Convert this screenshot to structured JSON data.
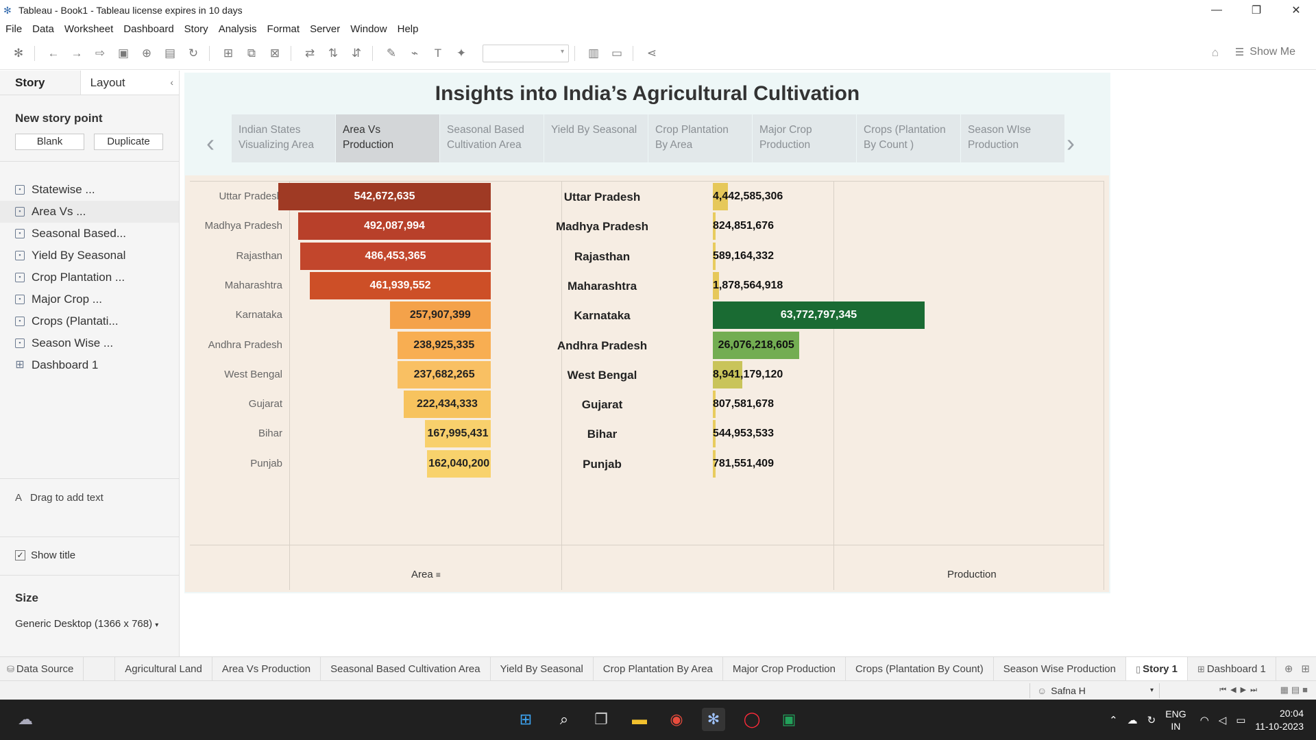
{
  "window": {
    "title": "Tableau - Book1 - Tableau license expires in 10 days",
    "controls": {
      "minimize": "—",
      "restore": "❐",
      "close": "✕"
    }
  },
  "menu": [
    "File",
    "Data",
    "Worksheet",
    "Dashboard",
    "Story",
    "Analysis",
    "Format",
    "Server",
    "Window",
    "Help"
  ],
  "toolbar": {
    "show_me": "Show Me"
  },
  "left_panel": {
    "tabs": {
      "story": "Story",
      "layout": "Layout"
    },
    "new_story_point": "New story point",
    "buttons": {
      "blank": "Blank",
      "duplicate": "Duplicate"
    },
    "story_points": [
      {
        "label": "Statewise ...",
        "icon": "sheet-icon"
      },
      {
        "label": "Area Vs ...",
        "icon": "sheet-icon"
      },
      {
        "label": "Seasonal Based...",
        "icon": "sheet-icon"
      },
      {
        "label": "Yield By Seasonal",
        "icon": "sheet-icon"
      },
      {
        "label": "Crop Plantation ...",
        "icon": "sheet-icon"
      },
      {
        "label": "Major Crop ...",
        "icon": "sheet-icon"
      },
      {
        "label": "Crops (Plantati...",
        "icon": "sheet-icon"
      },
      {
        "label": "Season Wise ...",
        "icon": "sheet-icon"
      },
      {
        "label": "Dashboard 1",
        "icon": "dashboard-icon"
      }
    ],
    "drag_text": "Drag to add text",
    "show_title": "Show title",
    "size_label": "Size",
    "size_value": "Generic Desktop (1366 x 768)"
  },
  "story": {
    "title": "Insights into India’s Agricultural Cultivation",
    "tabs": [
      {
        "line1": "Indian States",
        "line2": "Visualizing Area"
      },
      {
        "line1": "Area Vs",
        "line2": "Production"
      },
      {
        "line1": "Seasonal Based",
        "line2": "Cultivation Area"
      },
      {
        "line1": "Yield By Seasonal",
        "line2": ""
      },
      {
        "line1": "Crop Plantation",
        "line2": "By Area"
      },
      {
        "line1": "Major Crop",
        "line2": "Production"
      },
      {
        "line1": "Crops (Plantation",
        "line2": "By Count )"
      },
      {
        "line1": "Season WIse",
        "line2": "Production"
      }
    ]
  },
  "chart_data": {
    "type": "bar",
    "categories": [
      "Uttar Pradesh",
      "Madhya Pradesh",
      "Rajasthan",
      "Maharashtra",
      "Karnataka",
      "Andhra Pradesh",
      "West Bengal",
      "Gujarat",
      "Bihar",
      "Punjab"
    ],
    "series": [
      {
        "name": "Area",
        "values": [
          542672635,
          492087994,
          486453365,
          461939552,
          257907399,
          238925335,
          237682265,
          222434333,
          167995431,
          162040200
        ],
        "labels": [
          "542,672,635",
          "492,087,994",
          "486,453,365",
          "461,939,552",
          "257,907,399",
          "238,925,335",
          "237,682,265",
          "222,434,333",
          "167,995,431",
          "162,040,200"
        ],
        "colors": [
          "#9f3a24",
          "#b8402a",
          "#c2462c",
          "#cd4f27",
          "#f4a24a",
          "#f8ae52",
          "#f9c063",
          "#f7c35e",
          "#f8d06c",
          "#f8d26c"
        ]
      },
      {
        "name": "Production",
        "values": [
          4442585306,
          824851676,
          589164332,
          1878564918,
          63772797345,
          26076218605,
          8941179120,
          807581678,
          544953533,
          781551409
        ],
        "labels": [
          "4,442,585,306",
          "824,851,676",
          "589,164,332",
          "1,878,564,918",
          "63,772,797,345",
          "26,076,218,605",
          "8,941,179,120",
          "807,581,678",
          "544,953,533",
          "781,551,409"
        ],
        "colors": [
          "#e6c85a",
          "#e8cc5e",
          "#e8cc5e",
          "#e6c85a",
          "#1a6b33",
          "#73ad52",
          "#c9c45a",
          "#e8cc5e",
          "#e8cc5e",
          "#e8cc5e"
        ]
      }
    ],
    "xlabel_area": "Area",
    "xlabel_production": "Production",
    "area_max": 542672635,
    "production_max": 63772797345
  },
  "sheet_tabs": [
    "Data Source",
    "Agricultural Land",
    "Area Vs Production",
    "Seasonal Based Cultivation Area",
    "Yield By Seasonal",
    "Crop Plantation By Area",
    "Major Crop Production",
    "Crops (Plantation By Count)",
    "Season Wise Production",
    "Story 1",
    "Dashboard 1"
  ],
  "status": {
    "user": "Safna H"
  },
  "taskbar": {
    "lang": "ENG",
    "region": "IN",
    "time": "20:04",
    "date": "11-10-2023"
  }
}
